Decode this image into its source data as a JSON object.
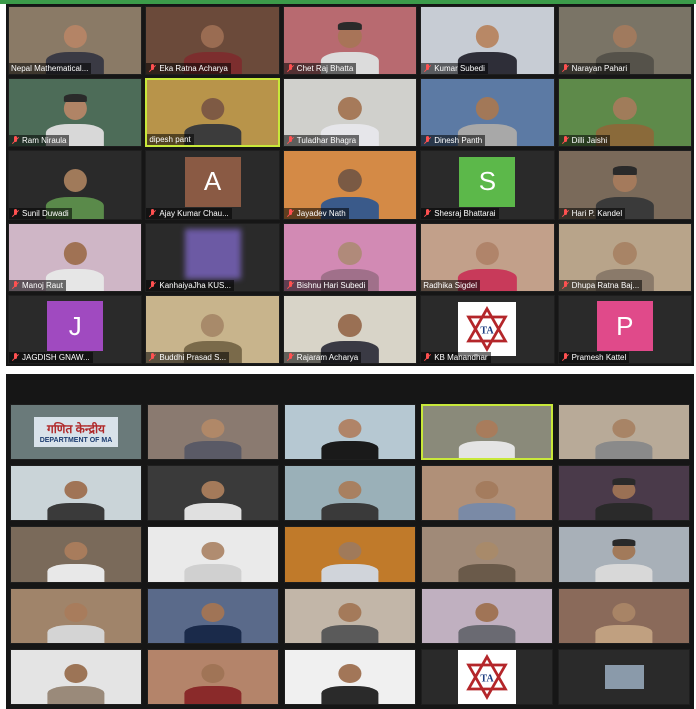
{
  "colors": {
    "top_accent": "#3c9b4a",
    "grid_background": "#161616",
    "muted_mic": "#ff5050",
    "active_speaker_border": "#c8e83a"
  },
  "top_grid": {
    "tiles": [
      {
        "name": "Nepal Mathematical...",
        "muted": false,
        "kind": "video",
        "bg": "#8a7a66",
        "skin": "#b48466",
        "shirt": "#3a3a44"
      },
      {
        "name": "Eka Ratna Acharya",
        "muted": true,
        "kind": "video",
        "bg": "#6b4a3a",
        "skin": "#9a6c52",
        "shirt": "#7c2e2e"
      },
      {
        "name": "Chet Raj Bhatta",
        "muted": true,
        "kind": "video",
        "bg": "#b86a70",
        "skin": "#a87458",
        "shirt": "#dcdcdc",
        "cap": true
      },
      {
        "name": "Kumar Subedi",
        "muted": true,
        "kind": "video",
        "bg": "#c7ccd4",
        "skin": "#b88866",
        "shirt": "#2e2e38"
      },
      {
        "name": "Narayan Pahari",
        "muted": true,
        "kind": "video",
        "bg": "#7a7466",
        "skin": "#a07a5e",
        "shirt": "#55524a"
      },
      {
        "name": "Ram Niraula",
        "muted": true,
        "kind": "video",
        "bg": "#4d6c58",
        "skin": "#b08466",
        "shirt": "#d8d8d8",
        "cap": true
      },
      {
        "name": "dipesh pant",
        "muted": false,
        "kind": "video",
        "bg": "#b8944a",
        "skin": "#7e5a44",
        "shirt": "#3c3c3c",
        "active": true
      },
      {
        "name": "Tuladhar Bhagra",
        "muted": true,
        "kind": "video",
        "bg": "#d0d0cc",
        "skin": "#a67a5a",
        "shirt": "#e6e6ea"
      },
      {
        "name": "Dinesh Panth",
        "muted": true,
        "kind": "video",
        "bg": "#5c7aa4",
        "skin": "#a27858",
        "shirt": "#a8a8a8"
      },
      {
        "name": "Dilli Jaishi",
        "muted": true,
        "kind": "video",
        "bg": "#5e8a4a",
        "skin": "#a07c5a",
        "shirt": "#8a6a3a"
      },
      {
        "name": "Sunil Duwadi",
        "muted": true,
        "kind": "video",
        "bg": "#2a2a2a",
        "skin": "#a07a5a",
        "shirt": "#5a8a4a"
      },
      {
        "name": "Ajay Kumar Chau...",
        "muted": true,
        "kind": "avatar",
        "letter": "A",
        "avatar_color": "#8a5a44"
      },
      {
        "name": "Jayadev Nath",
        "muted": true,
        "kind": "video",
        "bg": "#d48a46",
        "skin": "#7a5a44",
        "shirt": "#3a5a8a"
      },
      {
        "name": "Shesraj Bhattarai",
        "muted": true,
        "kind": "avatar",
        "letter": "S",
        "avatar_color": "#5cb84a"
      },
      {
        "name": "Hari P. Kandel",
        "muted": true,
        "kind": "video",
        "bg": "#7a6a5a",
        "skin": "#a47a5c",
        "shirt": "#3a3a3a",
        "cap": true
      },
      {
        "name": "Manoj Raut",
        "muted": true,
        "kind": "video",
        "bg": "#cfb6c6",
        "skin": "#a07254",
        "shirt": "#e6e6e6"
      },
      {
        "name": "KanhaiyaJha KUS...",
        "muted": true,
        "kind": "blur",
        "bg": "#6c5aa4"
      },
      {
        "name": "Bishnu Hari Subedi",
        "muted": true,
        "kind": "video",
        "bg": "#d28ab4",
        "skin": "#b08a7a",
        "shirt": "#a0708a"
      },
      {
        "name": "Radhika Sigdel",
        "muted": false,
        "kind": "video",
        "bg": "#c2a08a",
        "skin": "#b0846a",
        "shirt": "#c83a5a"
      },
      {
        "name": "Dhupa Ratna Baj...",
        "muted": true,
        "kind": "video",
        "bg": "#b8a48a",
        "skin": "#a88466",
        "shirt": "#8a7a6a"
      },
      {
        "name": "JAGDISH GNAW...",
        "muted": true,
        "kind": "avatar",
        "letter": "J",
        "avatar_color": "#a04ac0"
      },
      {
        "name": "Buddhi Prasad S...",
        "muted": true,
        "kind": "video",
        "bg": "#c8b48c",
        "skin": "#a88a6a",
        "shirt": "#7a6a4a"
      },
      {
        "name": "Rajaram Acharya",
        "muted": true,
        "kind": "video",
        "bg": "#d8d4c8",
        "skin": "#9a7054",
        "shirt": "#3a3a44"
      },
      {
        "name": "KB Manandhar",
        "muted": true,
        "kind": "logo"
      },
      {
        "name": "Pramesh Kattel",
        "muted": true,
        "kind": "avatar",
        "letter": "P",
        "avatar_color": "#e04a8a"
      }
    ]
  },
  "bottom_grid": {
    "tiles": [
      {
        "kind": "sign",
        "sign_line1": "गणित केन्द्रीय",
        "sign_line2": "DEPARTMENT OF MA"
      },
      {
        "kind": "video",
        "bg": "#8a7a70",
        "skin": "#b08868",
        "shirt": "#5a5a66"
      },
      {
        "kind": "video",
        "bg": "#b6c8d2",
        "skin": "#b08468",
        "shirt": "#1a1a1a"
      },
      {
        "kind": "video",
        "bg": "#8a8a7a",
        "skin": "#a87c5c",
        "shirt": "#e4e4e4",
        "active": true
      },
      {
        "kind": "video",
        "bg": "#b8aa98",
        "skin": "#a88466",
        "shirt": "#8a8a8a"
      },
      {
        "kind": "video",
        "bg": "#cad4d8",
        "skin": "#a07456",
        "shirt": "#3a3a3a"
      },
      {
        "kind": "video",
        "bg": "#3a3a3a",
        "skin": "#a47a5a",
        "shirt": "#e0e0e0"
      },
      {
        "kind": "video",
        "bg": "#9ab0b8",
        "skin": "#a88060",
        "shirt": "#3a3a3a"
      },
      {
        "kind": "video",
        "bg": "#b09078",
        "skin": "#a47c5e",
        "shirt": "#7a8aa6"
      },
      {
        "kind": "video",
        "bg": "#4a3a4a",
        "skin": "#9a7054",
        "shirt": "#2a2a2a",
        "cap": true
      },
      {
        "kind": "video",
        "bg": "#7a6a5a",
        "skin": "#a87c5c",
        "shirt": "#e8e8e8"
      },
      {
        "kind": "video",
        "bg": "#eaeaea",
        "skin": "#b08c70",
        "shirt": "#d0d0d0"
      },
      {
        "kind": "video",
        "bg": "#c07a2a",
        "skin": "#a07a5a",
        "shirt": "#d0d4da"
      },
      {
        "kind": "video",
        "bg": "#a08a78",
        "skin": "#a88a6a",
        "shirt": "#6a5a4a"
      },
      {
        "kind": "video",
        "bg": "#a8b0b8",
        "skin": "#a27a5a",
        "shirt": "#d8d8d8",
        "cap": true
      },
      {
        "kind": "video",
        "bg": "#a0846a",
        "skin": "#a87c5c",
        "shirt": "#d4d4d4"
      },
      {
        "kind": "video",
        "bg": "#5a6a8a",
        "skin": "#a07456",
        "shirt": "#1a2a4a"
      },
      {
        "kind": "video",
        "bg": "#c2b6a8",
        "skin": "#a47a5a",
        "shirt": "#5a5a5a"
      },
      {
        "kind": "video",
        "bg": "#c0b0c0",
        "skin": "#a07456",
        "shirt": "#6a6a72"
      },
      {
        "kind": "video",
        "bg": "#8a6a5a",
        "skin": "#a88466",
        "shirt": "#c0a080"
      },
      {
        "kind": "video",
        "bg": "#e4e4e4",
        "skin": "#9c7456",
        "shirt": "#9a8a7a"
      },
      {
        "kind": "video",
        "bg": "#b4846a",
        "skin": "#a07456",
        "shirt": "#8a2a2a"
      },
      {
        "kind": "video",
        "bg": "#f0f0f0",
        "skin": "#a27658",
        "shirt": "#2a2a2a"
      },
      {
        "kind": "logo"
      },
      {
        "kind": "plain",
        "bg": "#2a2a2a",
        "inner": "#8a9aaa"
      }
    ]
  }
}
